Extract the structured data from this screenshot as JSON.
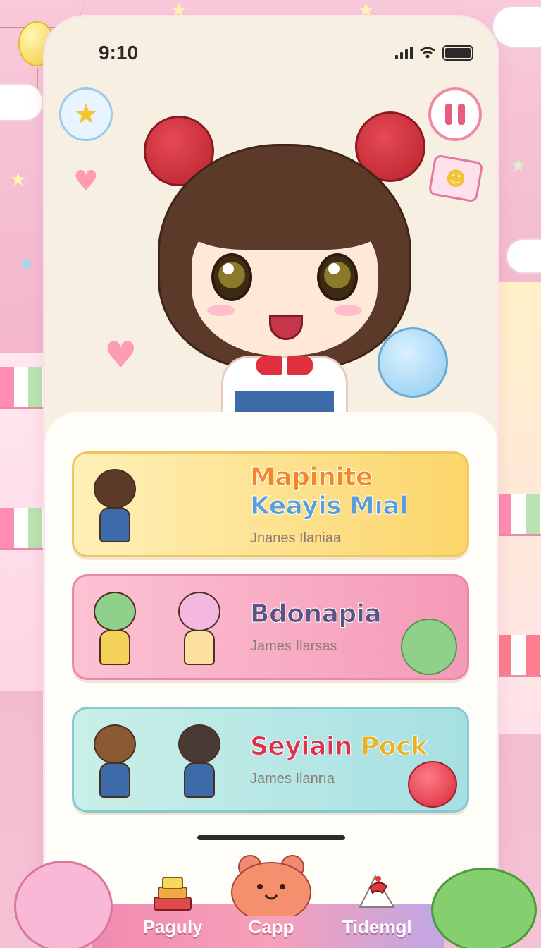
{
  "status_bar": {
    "time": "9:10",
    "signal_icon": "signal-icon",
    "wifi_icon": "wifi-icon",
    "battery_icon": "battery-icon"
  },
  "hero": {
    "star_button_icon": "star-icon",
    "pause_button_icon": "pause-icon"
  },
  "cards": [
    {
      "title_parts": [
        "Mapinite",
        "Keayis",
        "Mıal"
      ],
      "subtitle": "Jnanes Ilaniaa"
    },
    {
      "title": "Bdonapia",
      "subtitle": "James Ilarsas"
    },
    {
      "title_parts": [
        "Seyiain",
        "Pock"
      ],
      "subtitle": "James Ilanrıa"
    }
  ],
  "nav": {
    "items": [
      {
        "label": "Paguly",
        "icon": "gift-stack-icon"
      },
      {
        "label": "Capp",
        "icon": "bear-icon"
      },
      {
        "label": "Tidemgl",
        "icon": "cake-icon"
      }
    ]
  },
  "colors": {
    "accent_pink": "#f08ab0",
    "card_yellow": "#fbd56a",
    "card_pink": "#f59ab7",
    "card_teal": "#a6e0e3"
  }
}
